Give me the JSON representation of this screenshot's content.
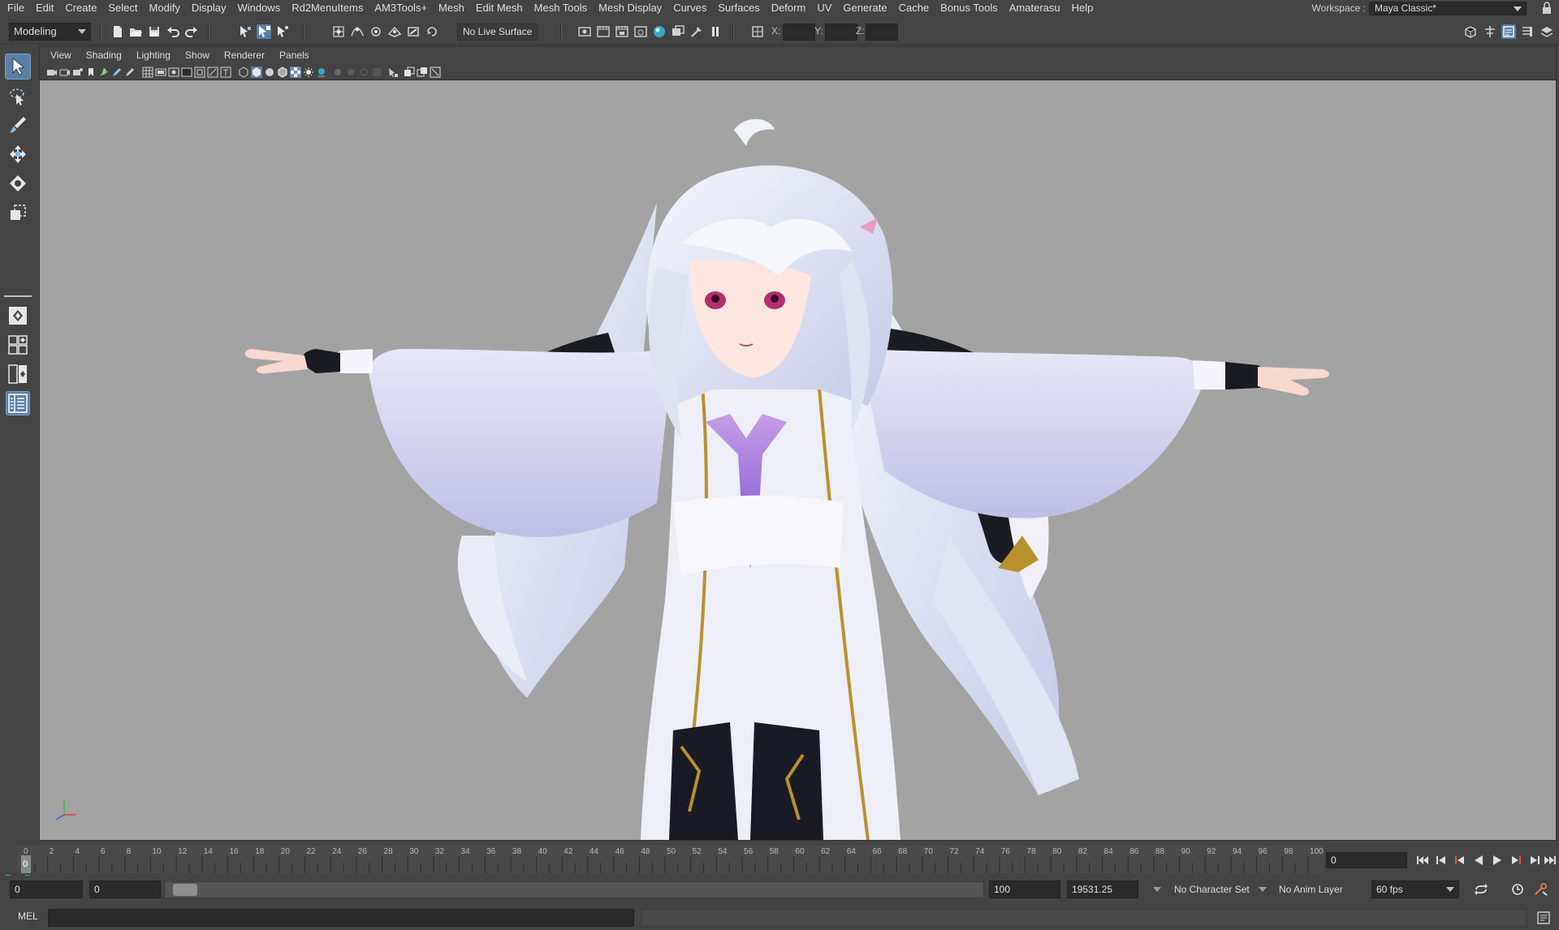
{
  "menubar": {
    "items": [
      "File",
      "Edit",
      "Create",
      "Select",
      "Modify",
      "Display",
      "Windows",
      "Rd2MenuItems",
      "AM3Tools+",
      "Mesh",
      "Edit Mesh",
      "Mesh Tools",
      "Mesh Display",
      "Curves",
      "Surfaces",
      "Deform",
      "UV",
      "Generate",
      "Cache",
      "Bonus Tools",
      "Amaterasu",
      "Help"
    ],
    "workspace_label": "Workspace :",
    "workspace_value": "Maya Classic*"
  },
  "statusline": {
    "mode": "Modeling",
    "live_surface": "No Live Surface",
    "x_label": "X:",
    "y_label": "Y:",
    "z_label": "Z:",
    "x_value": "",
    "y_value": "",
    "z_value": ""
  },
  "panel": {
    "menus": [
      "View",
      "Shading",
      "Lighting",
      "Show",
      "Renderer",
      "Panels"
    ]
  },
  "timeline": {
    "ticks": [
      "0",
      "2",
      "4",
      "6",
      "8",
      "10",
      "12",
      "14",
      "16",
      "18",
      "20",
      "22",
      "24",
      "26",
      "28",
      "30",
      "32",
      "34",
      "36",
      "38",
      "40",
      "42",
      "44",
      "46",
      "48",
      "50",
      "52",
      "54",
      "56",
      "58",
      "60",
      "62",
      "64",
      "66",
      "68",
      "70",
      "72",
      "74",
      "76",
      "78",
      "80",
      "82",
      "84",
      "86",
      "88",
      "90",
      "92",
      "94",
      "96",
      "98",
      "100"
    ],
    "current_frame_marker": "0",
    "current_frame": "0"
  },
  "range": {
    "start": "0",
    "playback_start": "0",
    "playback_end": "100",
    "end": "19531.25",
    "character_set": "No Character Set",
    "anim_layer": "No Anim Layer",
    "fps": "60 fps"
  },
  "cmdline": {
    "label": "MEL"
  },
  "colors": {
    "ui_bg": "#444444",
    "viewport_bg": "#a3a3a3",
    "active_tool": "#5a7fa6",
    "field_bg": "#2a2a2a",
    "maya_logo": "#1fb6b3"
  }
}
